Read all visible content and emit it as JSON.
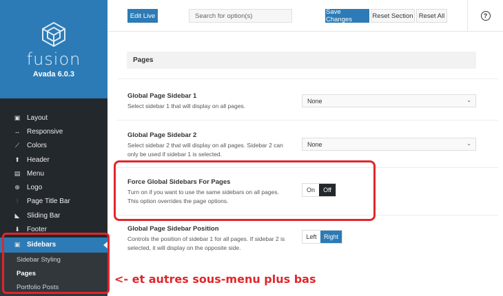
{
  "brand": {
    "name": "fusion",
    "version": "Avada 6.0.3",
    "logo_icon": "fusion-cube-logo"
  },
  "sidebar": {
    "items": [
      {
        "label": "Layout",
        "icon": "layout-icon"
      },
      {
        "label": "Responsive",
        "icon": "arrows-horizontal-icon"
      },
      {
        "label": "Colors",
        "icon": "brush-icon"
      },
      {
        "label": "Header",
        "icon": "arrow-up-icon"
      },
      {
        "label": "Menu",
        "icon": "menu-icon"
      },
      {
        "label": "Logo",
        "icon": "plus-circle-icon"
      },
      {
        "label": "Page Title Bar",
        "icon": "sliders-icon"
      },
      {
        "label": "Sliding Bar",
        "icon": "sliding-bar-icon"
      },
      {
        "label": "Footer",
        "icon": "arrow-down-icon"
      },
      {
        "label": "Sidebars",
        "icon": "sidebar-icon",
        "active": true
      }
    ],
    "subitems": [
      {
        "label": "Sidebar Styling"
      },
      {
        "label": "Pages",
        "current": true
      },
      {
        "label": "Portfolio Posts"
      }
    ]
  },
  "toolbar": {
    "edit_live": "Edit Live",
    "search_placeholder": "Search for option(s)",
    "save_changes": "Save Changes",
    "reset_section": "Reset Section",
    "reset_all": "Reset All",
    "help": "?"
  },
  "section": {
    "title": "Pages"
  },
  "options": [
    {
      "title": "Global Page Sidebar 1",
      "desc": "Select sidebar 1 that will display on all pages.",
      "value": "None"
    },
    {
      "title": "Global Page Sidebar 2",
      "desc": "Select sidebar 2 that will display on all pages. Sidebar 2 can only be used if sidebar 1 is selected.",
      "value": "None"
    },
    {
      "title": "Force Global Sidebars For Pages",
      "desc": "Turn on if you want to use the same sidebars on all pages. This option overrides the page options.",
      "choices": [
        "On",
        "Off"
      ],
      "selected": "Off"
    },
    {
      "title": "Global Page Sidebar Position",
      "desc": "Controls the position of sidebar 1 for all pages. If sidebar 2 is selected, it will display on the opposite side.",
      "choices": [
        "Left",
        "Right"
      ],
      "selected": "Right"
    }
  ],
  "annotation": {
    "text": "<- et autres sous-menu plus bas",
    "color": "#e0262b"
  },
  "colors": {
    "accent": "#2c7bb6",
    "sidebar_bg": "#23282d",
    "annotation": "#e0262b"
  }
}
